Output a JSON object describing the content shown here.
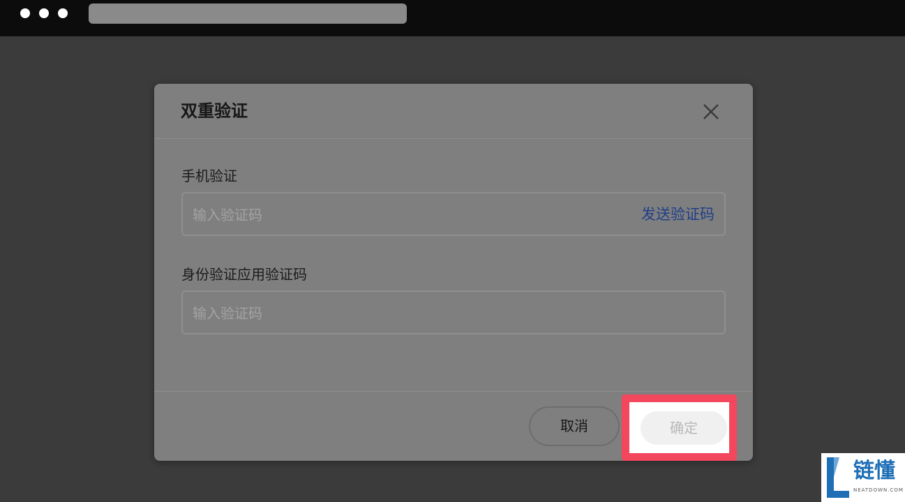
{
  "dialog": {
    "title": "双重验证",
    "phone": {
      "label": "手机验证",
      "placeholder": "输入验证码",
      "send_code": "发送验证码"
    },
    "auth_app": {
      "label": "身份验证应用验证码",
      "placeholder": "输入验证码"
    },
    "cancel_label": "取消",
    "confirm_label": "确定"
  },
  "watermark": {
    "name": "链懂",
    "domain": "NEATDOWN.COM"
  },
  "colors": {
    "highlight": "#f2475d",
    "link": "#1f3f88",
    "brand": "#1f6fb6"
  },
  "icons": [
    "close-icon",
    "neatdown-logo-icon"
  ]
}
